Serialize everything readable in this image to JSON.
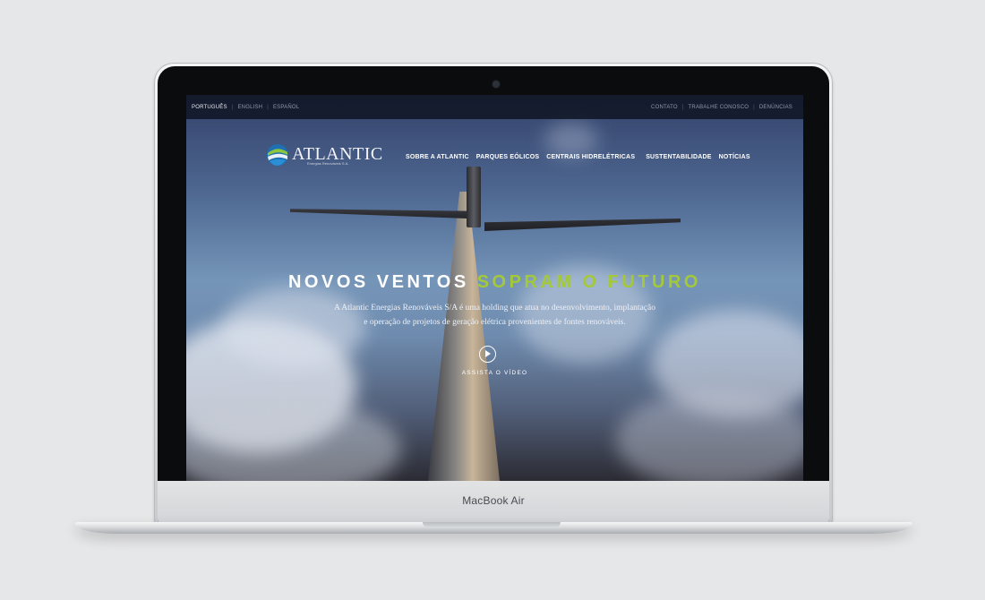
{
  "laptop": {
    "model_label": "MacBook Air"
  },
  "topbar": {
    "languages": [
      "PORTUGUÊS",
      "ENGLISH",
      "ESPAÑOL"
    ],
    "links": [
      "CONTATO",
      "TRABALHE CONOSCO",
      "DENÚNCIAS"
    ],
    "separator": "|"
  },
  "brand": {
    "name": "ATLANTIC",
    "tagline": "Energias Renováveis S.A."
  },
  "nav": {
    "items": [
      "SOBRE A ATLANTIC",
      "PARQUES EÓLICOS",
      "CENTRAIS HIDRELÉTRICAS",
      "SUSTENTABILIDADE",
      "NOTÍCIAS"
    ]
  },
  "hero": {
    "title_part1": "NOVOS VENTOS",
    "title_part2": "SOPRAM O FUTURO",
    "description_line1": "A Atlantic Energias Renováveis S/A é uma holding que atua no desenvolvimento, implantação",
    "description_line2": "e operação de projetos de geração elétrica provenientes de fontes renováveis.",
    "watch_video": "ASSISTA O VÍDEO"
  },
  "colors": {
    "accent": "#a3c93a",
    "background": "#e6e7e8"
  }
}
